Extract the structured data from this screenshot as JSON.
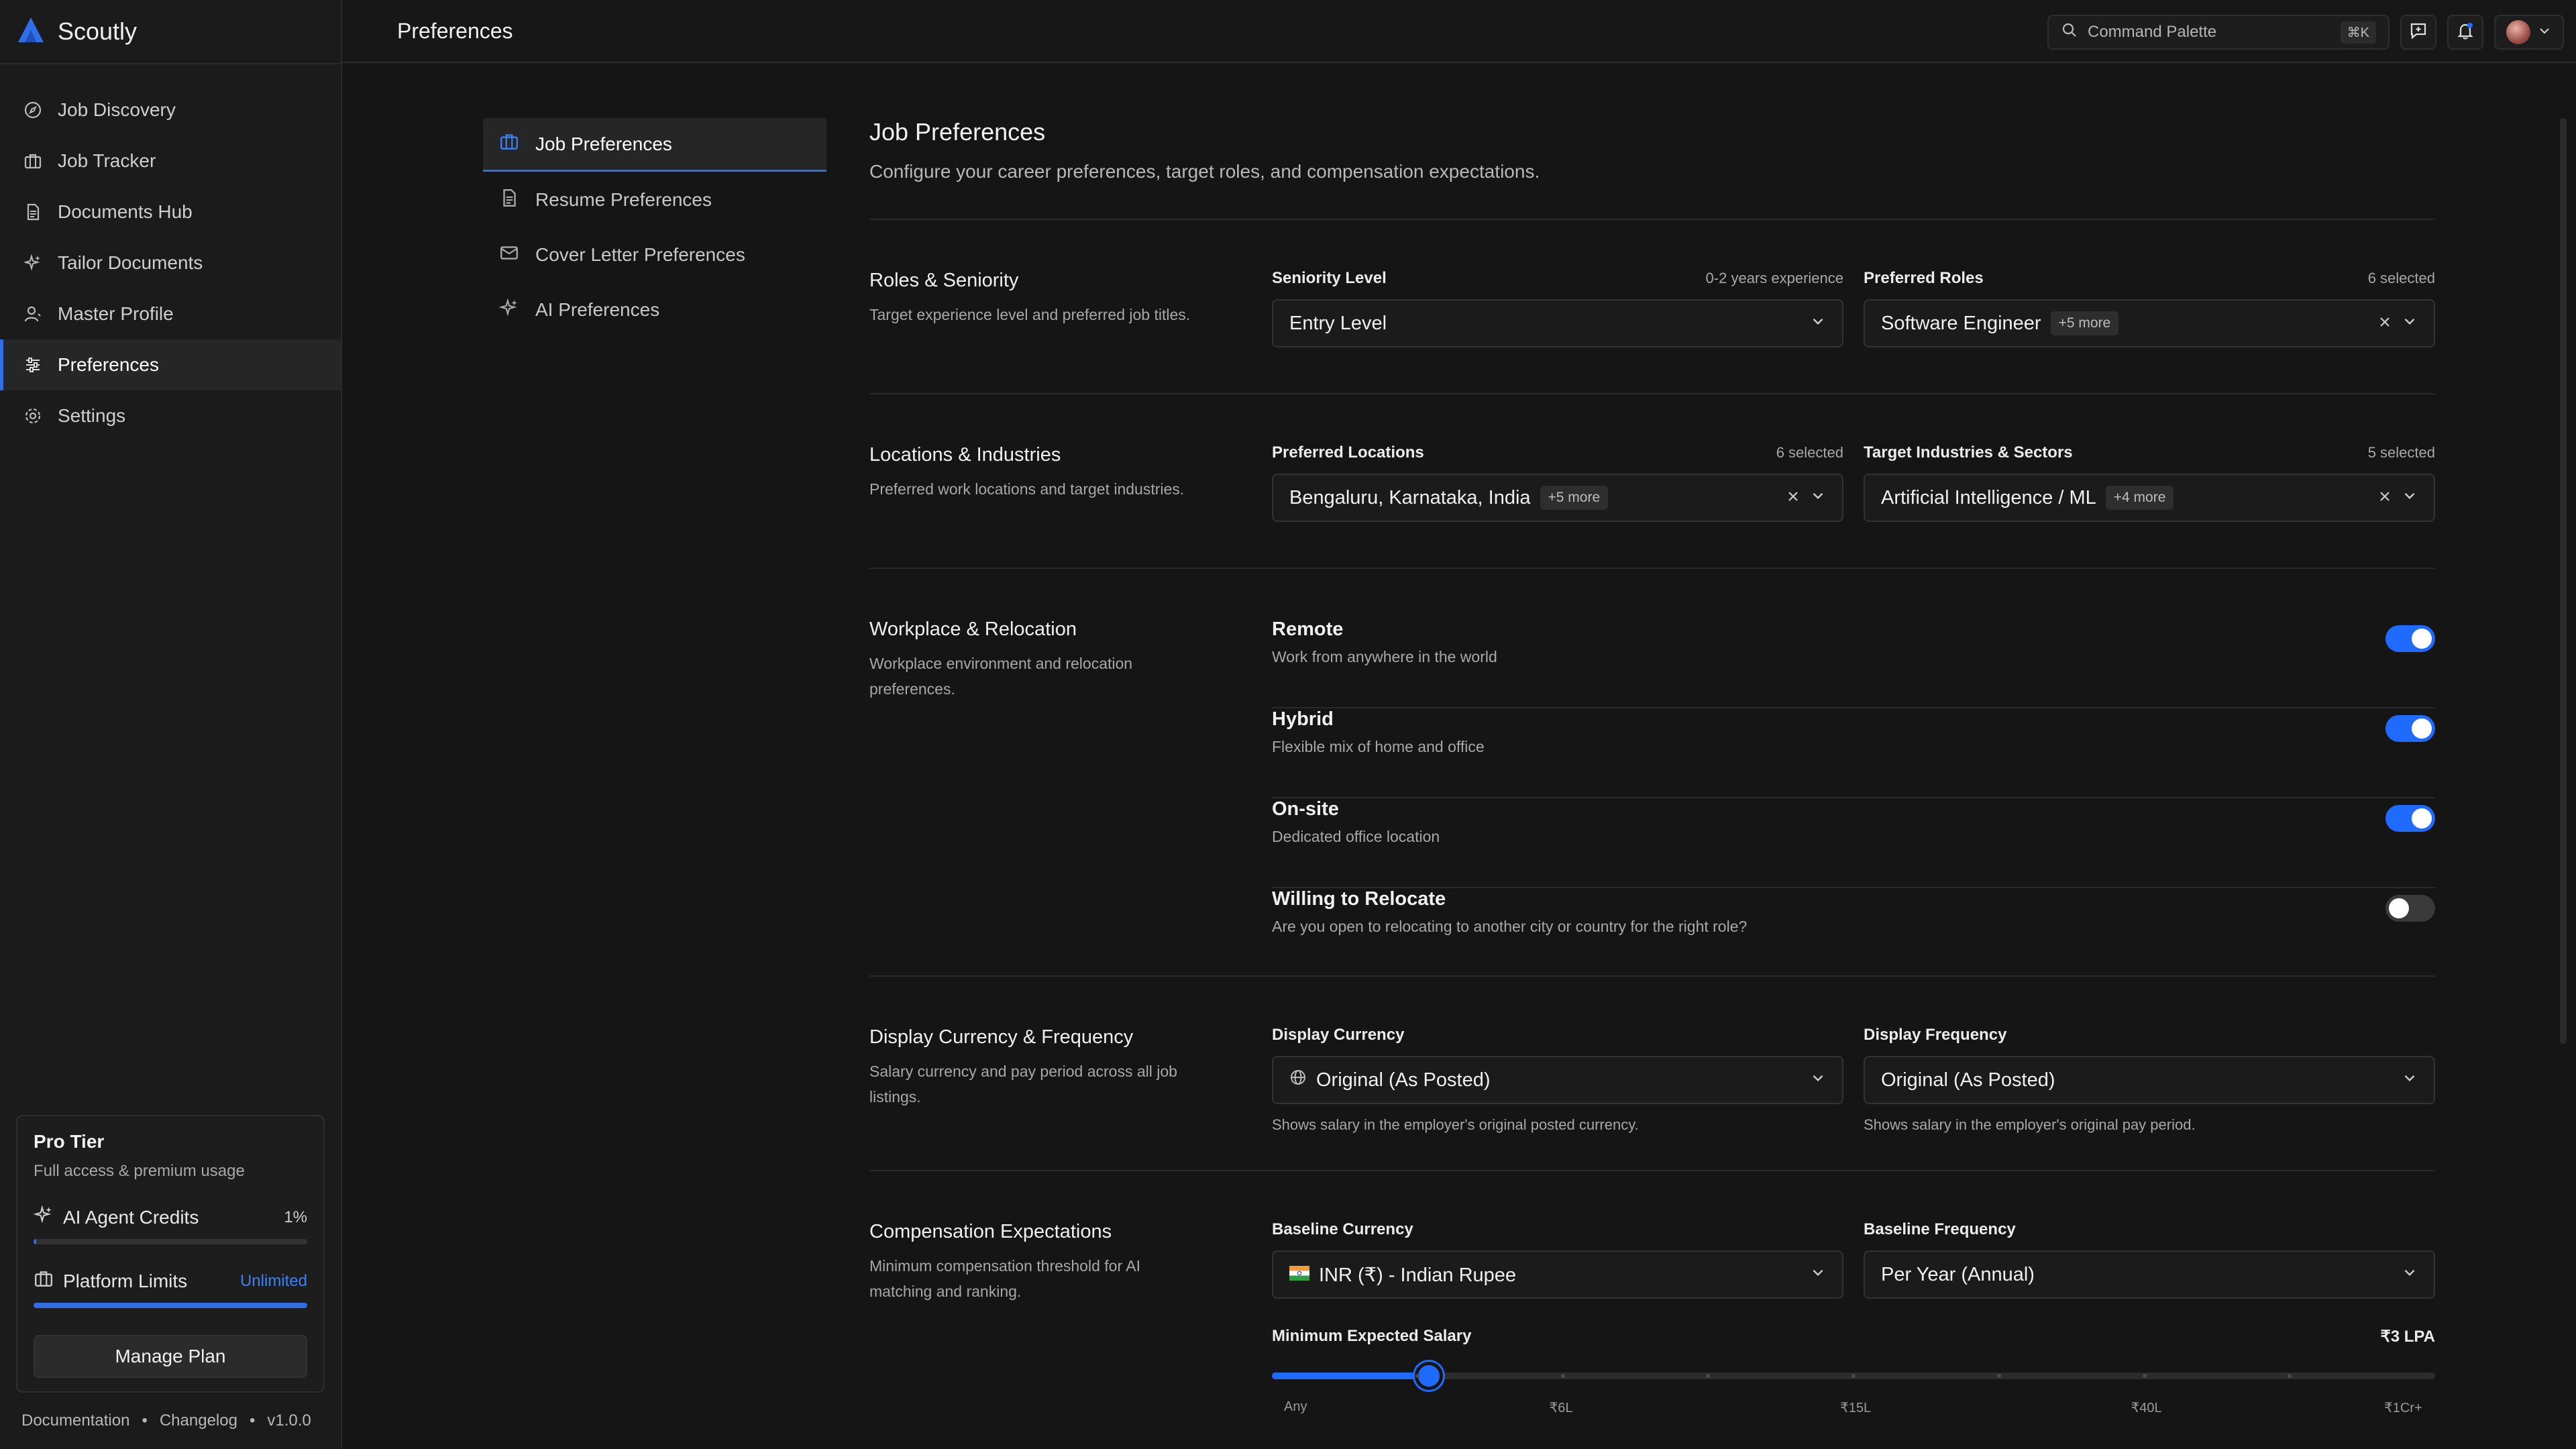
{
  "app": {
    "name": "Scoutly"
  },
  "header": {
    "title": "Preferences",
    "command_palette": "Command Palette",
    "shortcut": "⌘K"
  },
  "sidebar": {
    "items": [
      {
        "label": "Job Discovery",
        "icon": "compass-icon"
      },
      {
        "label": "Job Tracker",
        "icon": "briefcase-icon"
      },
      {
        "label": "Documents Hub",
        "icon": "document-icon"
      },
      {
        "label": "Tailor Documents",
        "icon": "sparkles-icon"
      },
      {
        "label": "Master Profile",
        "icon": "user-icon"
      },
      {
        "label": "Preferences",
        "icon": "sliders-icon",
        "active": true
      },
      {
        "label": "Settings",
        "icon": "gear-icon"
      }
    ],
    "plan": {
      "title": "Pro Tier",
      "subtitle": "Full access & premium usage",
      "credits_label": "AI Agent Credits",
      "credits_value": "1%",
      "credits_fraction": 0.01,
      "limits_label": "Platform Limits",
      "limits_value": "Unlimited",
      "limits_fraction": 1.0,
      "manage_label": "Manage Plan"
    },
    "footer": {
      "docs": "Documentation",
      "sep": "•",
      "changelog": "Changelog",
      "version": "v1.0.0"
    }
  },
  "subnav": {
    "items": [
      {
        "label": "Job Preferences",
        "icon": "briefcase-icon",
        "active": true
      },
      {
        "label": "Resume Preferences",
        "icon": "document-icon"
      },
      {
        "label": "Cover Letter Preferences",
        "icon": "mail-icon"
      },
      {
        "label": "AI Preferences",
        "icon": "sparkles-icon"
      }
    ]
  },
  "page": {
    "title": "Job Preferences",
    "subtitle": "Configure your career preferences, target roles, and compensation expectations."
  },
  "roles": {
    "title": "Roles & Seniority",
    "desc": "Target experience level and preferred job titles.",
    "seniority_label": "Seniority Level",
    "seniority_meta": "0-2 years experience",
    "seniority_value": "Entry Level",
    "roles_label": "Preferred Roles",
    "roles_meta": "6 selected",
    "roles_value": "Software Engineer",
    "roles_more": "+5 more"
  },
  "locations": {
    "title": "Locations & Industries",
    "desc": "Preferred work locations and target industries.",
    "loc_label": "Preferred Locations",
    "loc_meta": "6 selected",
    "loc_value": "Bengaluru, Karnataka, India",
    "loc_more": "+5 more",
    "ind_label": "Target Industries & Sectors",
    "ind_meta": "5 selected",
    "ind_value": "Artificial Intelligence / ML",
    "ind_more": "+4 more"
  },
  "workplace": {
    "title": "Workplace & Relocation",
    "desc": "Workplace environment and relocation preferences.",
    "options": [
      {
        "title": "Remote",
        "desc": "Work from anywhere in the world",
        "on": true
      },
      {
        "title": "Hybrid",
        "desc": "Flexible mix of home and office",
        "on": true
      },
      {
        "title": "On-site",
        "desc": "Dedicated office location",
        "on": true
      },
      {
        "title": "Willing to Relocate",
        "desc": "Are you open to relocating to another city or country for the right role?",
        "on": false
      }
    ]
  },
  "display": {
    "title": "Display Currency & Frequency",
    "desc": "Salary currency and pay period across all job listings.",
    "currency_label": "Display Currency",
    "currency_value": "Original (As Posted)",
    "currency_hint": "Shows salary in the employer's original posted currency.",
    "freq_label": "Display Frequency",
    "freq_value": "Original (As Posted)",
    "freq_hint": "Shows salary in the employer's original pay period."
  },
  "compensation": {
    "title": "Compensation Expectations",
    "desc": "Minimum compensation threshold for AI matching and ranking.",
    "base_currency_label": "Baseline Currency",
    "base_currency_value": "INR (₹) - Indian Rupee",
    "base_freq_label": "Baseline Frequency",
    "base_freq_value": "Per Year (Annual)",
    "min_salary_label": "Minimum Expected Salary",
    "min_salary_value": "₹3 LPA",
    "slider_fraction": 0.135,
    "slider_ticks": [
      "Any",
      "₹6L",
      "₹15L",
      "₹40L",
      "₹1Cr+"
    ]
  },
  "colors": {
    "accent": "#1f6bff",
    "bg": "#151515",
    "sidebar": "#1b1b1b"
  }
}
